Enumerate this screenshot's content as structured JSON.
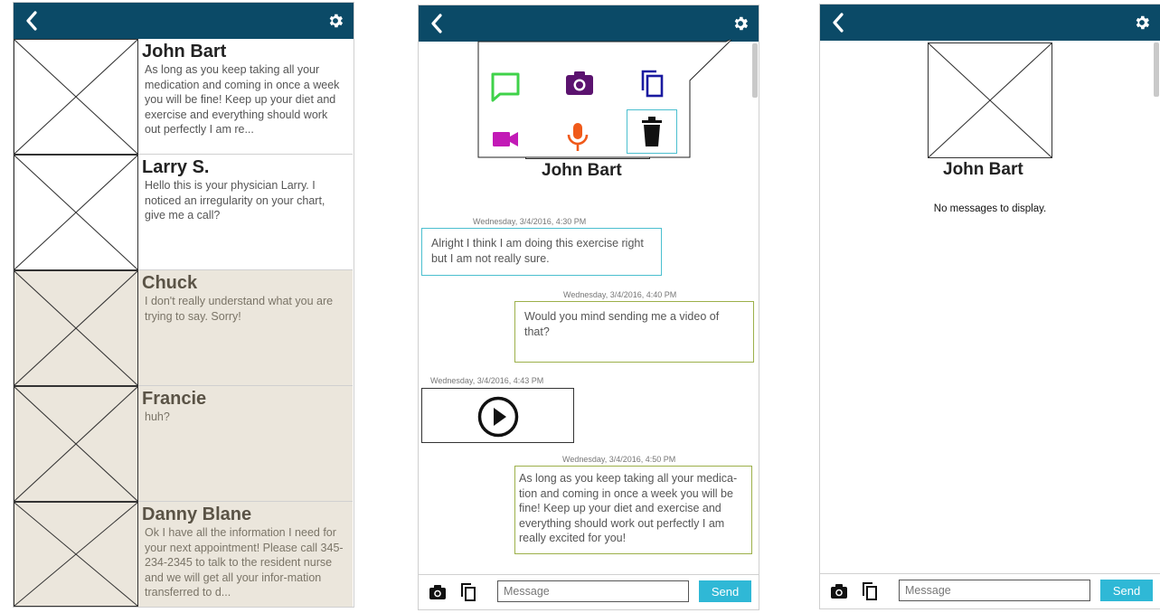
{
  "contact_list": {
    "items": [
      {
        "name": "John Bart",
        "preview": "As long as you keep taking all your medication and coming in once a week you will be fine! Keep up your diet and exercise and everything should work out perfectly I am re..."
      },
      {
        "name": "Larry S.",
        "preview": "Hello this is your physician Larry. I noticed an irregularity on your chart, give me a call?"
      },
      {
        "name": "Chuck",
        "preview": "I don't really understand what you are trying to say. Sorry!"
      },
      {
        "name": "Francie",
        "preview": "huh?"
      },
      {
        "name": "Danny Blane",
        "preview": "Ok I have all the information I need for your next appointment! Please call 345-234-2345 to talk to the resident nurse and we will get all your infor-mation transferred to d..."
      }
    ]
  },
  "chat": {
    "title": "John Bart",
    "messages": [
      {
        "timestamp": "Wednesday, 3/4/2016, 4:30 PM",
        "text": "Alright I think I am doing this exercise right but I am not really sure."
      },
      {
        "timestamp": "Wednesday, 3/4/2016, 4:40 PM",
        "text": "Would you mind sending me a video of that?"
      },
      {
        "timestamp": "Wednesday, 3/4/2016, 4:43 PM",
        "text": ""
      },
      {
        "timestamp": "Wednesday, 3/4/2016, 4:50 PM",
        "text": "As long as you keep taking all your medica-tion and coming in once a week you will be fine! Keep up your diet and exercise and everything should work out perfectly I am really excited for you!"
      }
    ],
    "attach_menu_icons": [
      "message-icon",
      "camera-icon",
      "copy-icon",
      "video-icon",
      "microphone-icon",
      "trash-icon"
    ],
    "input_placeholder": "Message",
    "send_label": "Send"
  },
  "empty_chat": {
    "title": "John Bart",
    "empty_text": "No messages to display.",
    "input_placeholder": "Message",
    "send_label": "Send"
  },
  "colors": {
    "topbar": "#0b4a67",
    "send_button": "#2fb8d6",
    "incoming_border": "#4bbfcf",
    "outgoing_border": "#9cb04a",
    "muted_row": "#ebe6dc"
  },
  "icons": {
    "back": "back-icon",
    "settings": "gear-icon",
    "play": "play-icon"
  }
}
